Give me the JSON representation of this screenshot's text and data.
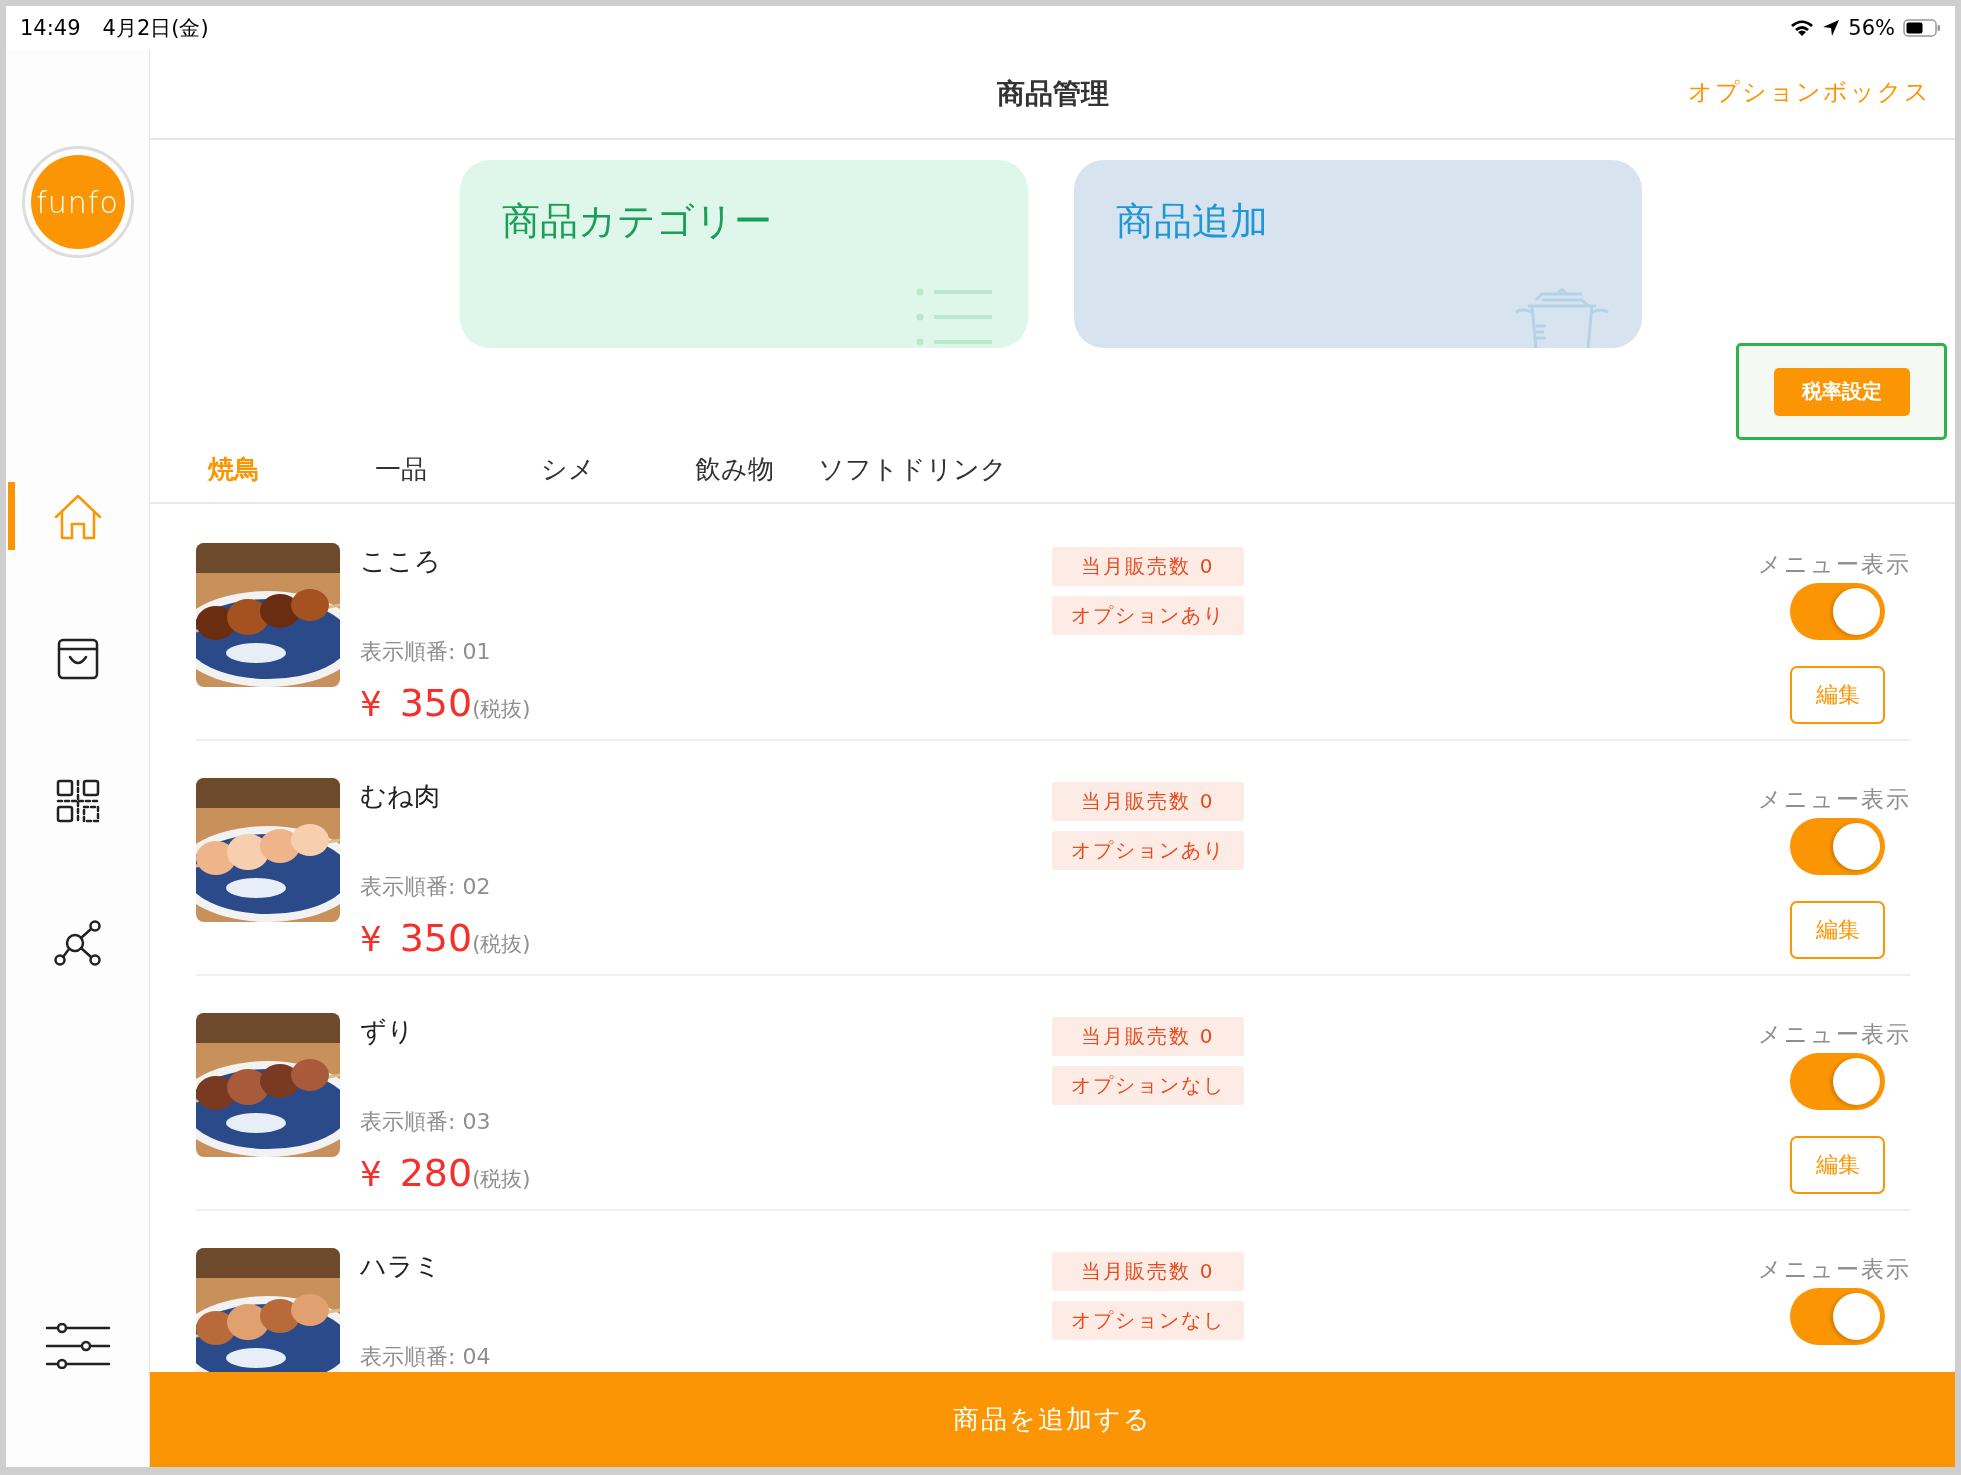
{
  "status_bar": {
    "time": "14:49",
    "date": "4月2日(金)",
    "battery": "56%"
  },
  "sidebar": {
    "logo": "funfo",
    "nav": [
      {
        "kind": "home",
        "selected": true
      },
      {
        "kind": "bag",
        "selected": false
      },
      {
        "kind": "qr",
        "selected": false
      },
      {
        "kind": "network",
        "selected": false
      },
      {
        "kind": "settings",
        "selected": false
      }
    ]
  },
  "header": {
    "title": "商品管理",
    "action": "オプションボックス"
  },
  "cards": [
    {
      "kind": "category",
      "label": "商品カテゴリー"
    },
    {
      "kind": "add",
      "label": "商品追加"
    }
  ],
  "tax_button": "税率設定",
  "tabs": [
    {
      "label": "焼鳥",
      "selected": true
    },
    {
      "label": "一品",
      "selected": false
    },
    {
      "label": "シメ",
      "selected": false
    },
    {
      "label": "飲み物",
      "selected": false
    },
    {
      "label": "ソフトドリンク",
      "selected": false
    }
  ],
  "products": [
    {
      "name": "こころ",
      "order": "表示順番: 01",
      "currency": "¥",
      "price": "350",
      "tax_note": "(税抜)",
      "sales": "当月販売数 0",
      "option": "オプションあり",
      "menu_label": "メニュー表示",
      "visible": true,
      "edit": "編集"
    },
    {
      "name": "むね肉",
      "order": "表示順番: 02",
      "currency": "¥",
      "price": "350",
      "tax_note": "(税抜)",
      "sales": "当月販売数 0",
      "option": "オプションあり",
      "menu_label": "メニュー表示",
      "visible": true,
      "edit": "編集"
    },
    {
      "name": "ずり",
      "order": "表示順番: 03",
      "currency": "¥",
      "price": "280",
      "tax_note": "(税抜)",
      "sales": "当月販売数 0",
      "option": "オプションなし",
      "menu_label": "メニュー表示",
      "visible": true,
      "edit": "編集"
    },
    {
      "name": "ハラミ",
      "order": "表示順番: 04",
      "sales": "当月販売数 0",
      "option": "オプションなし",
      "menu_label": "メニュー表示",
      "visible": true
    }
  ],
  "bottom_button": "商品を追加する"
}
